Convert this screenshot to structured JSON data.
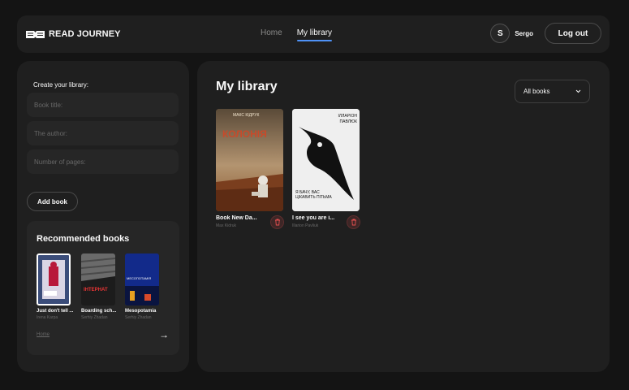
{
  "header": {
    "logo_text": "READ JOURNEY",
    "nav": [
      {
        "label": "Home"
      },
      {
        "label": "My library"
      }
    ],
    "user_initial": "S",
    "user_name": "Sergo",
    "logout_label": "Log out"
  },
  "sidebar": {
    "filter_title": "Create your library:",
    "fields": {
      "title_placeholder": "Book title:",
      "author_placeholder": "The author:",
      "pages_placeholder": "Number of pages:"
    },
    "add_button": "Add book",
    "recommended": {
      "title": "Recommended books",
      "books": [
        {
          "title": "Just don't tell ...",
          "author": "Irena Karpa"
        },
        {
          "title": "Boarding sch...",
          "author": "Serhiy Zhadan",
          "cover_text": "ІНТЕРНАТ"
        },
        {
          "title": "Mesopotamia",
          "author": "Serhiy Zhadan",
          "cover_text": "МЕСОПОТАМІЯ"
        }
      ],
      "home_link": "Home"
    }
  },
  "main": {
    "title": "My library",
    "filter_value": "All books",
    "books": [
      {
        "title": "Book New Da...",
        "author": "Max Kidruk",
        "cover_title": "КОЛОНІЯ",
        "cover_author": "МАКС КІДРУК"
      },
      {
        "title": "I see you are i...",
        "author": "Illarion Pavliuk",
        "cover_author": "ІЛЛАРІОН ПАВЛЮК",
        "cover_title": "Я БАЧУ, ВАС ЦІКАВИТЬ ПІТЬМА"
      }
    ]
  },
  "colors": {
    "background": "#141414",
    "panel": "#1f1f1f",
    "field": "#262626",
    "accent": "#4f92f7",
    "delete": "#e85050"
  }
}
